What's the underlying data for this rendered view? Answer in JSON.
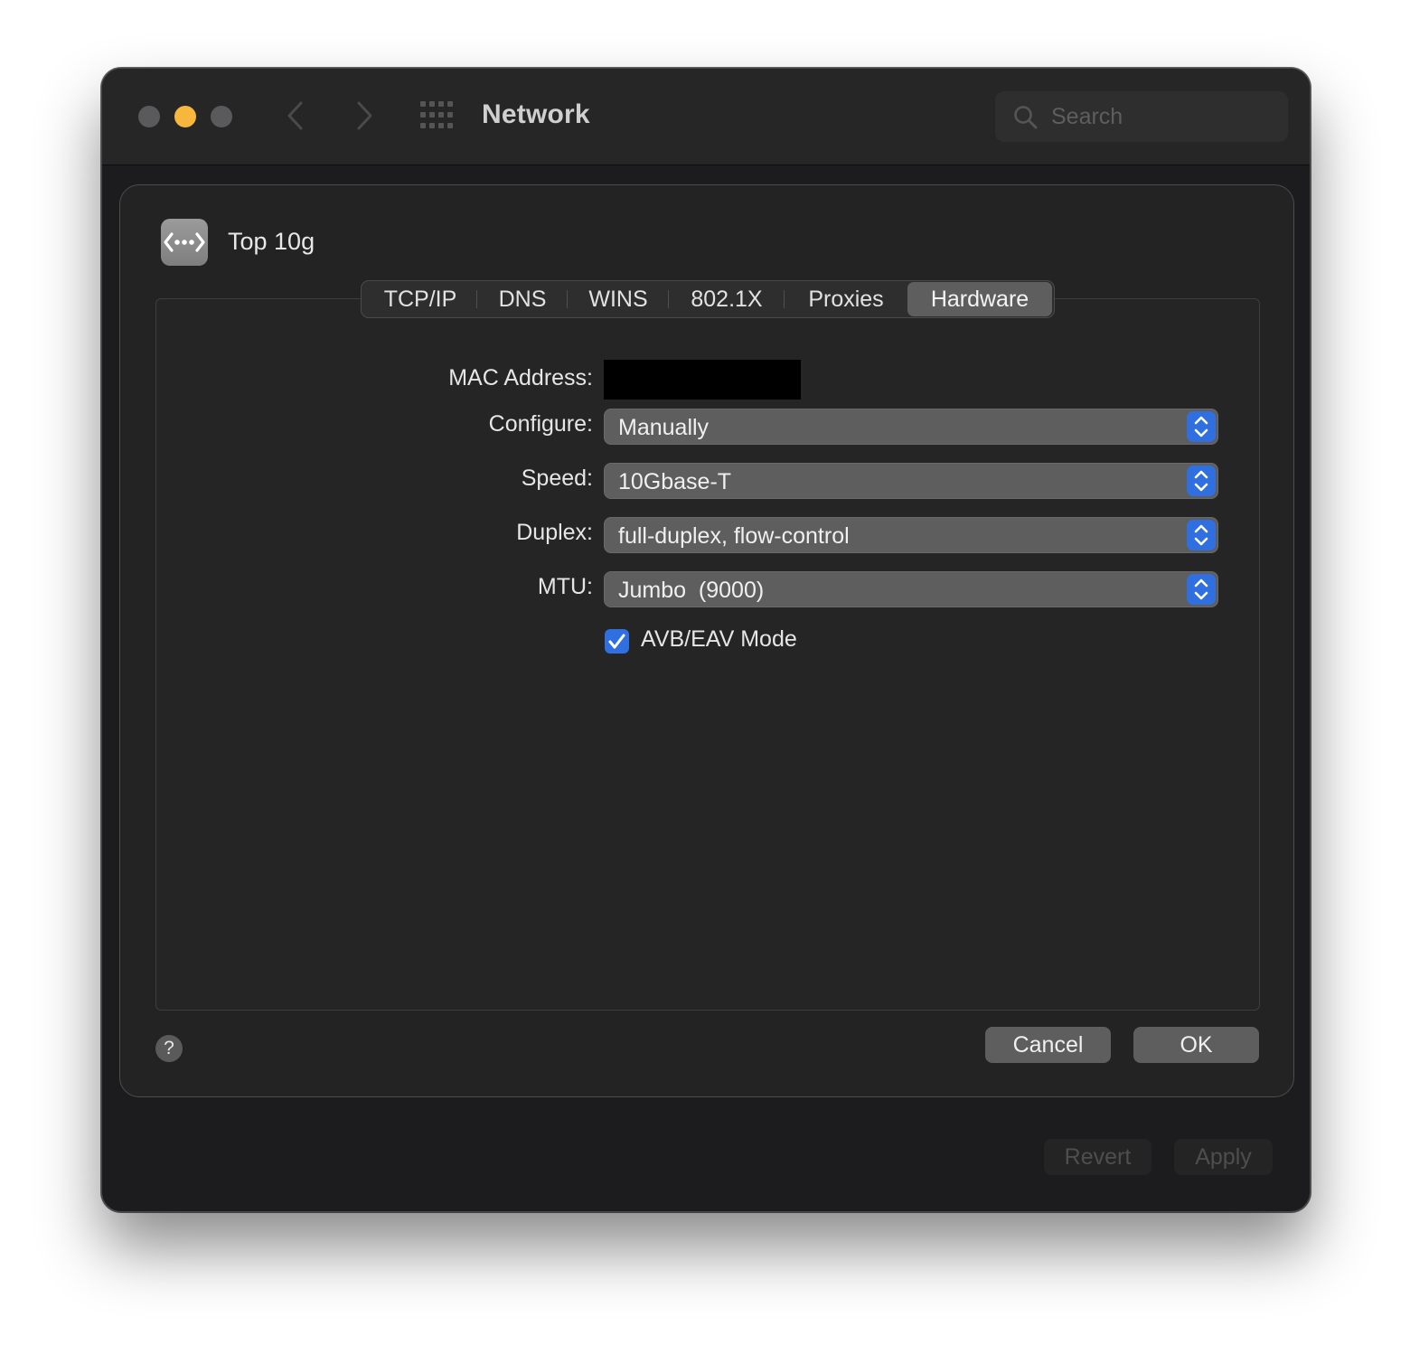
{
  "window": {
    "title": "Network",
    "search_placeholder": "Search"
  },
  "interface": {
    "name": "Top 10g",
    "icon": "network-interface-icon"
  },
  "tabs": [
    {
      "label": "TCP/IP",
      "active": false
    },
    {
      "label": "DNS",
      "active": false
    },
    {
      "label": "WINS",
      "active": false
    },
    {
      "label": "802.1X",
      "active": false
    },
    {
      "label": "Proxies",
      "active": false
    },
    {
      "label": "Hardware",
      "active": true
    }
  ],
  "hardware": {
    "mac_label": "MAC Address:",
    "configure_label": "Configure:",
    "configure_value": "Manually",
    "speed_label": "Speed:",
    "speed_value": "10Gbase-T",
    "duplex_label": "Duplex:",
    "duplex_value": "full-duplex, flow-control",
    "mtu_label": "MTU:",
    "mtu_value": "Jumbo  (9000)",
    "avb_label": "AVB/EAV Mode",
    "avb_checked": true
  },
  "buttons": {
    "help": "?",
    "cancel": "Cancel",
    "ok": "OK",
    "revert": "Revert",
    "apply": "Apply"
  },
  "colors": {
    "accent": "#2f6fe0",
    "minimize": "#f6b73c",
    "window_bg": "#1c1c1e"
  }
}
